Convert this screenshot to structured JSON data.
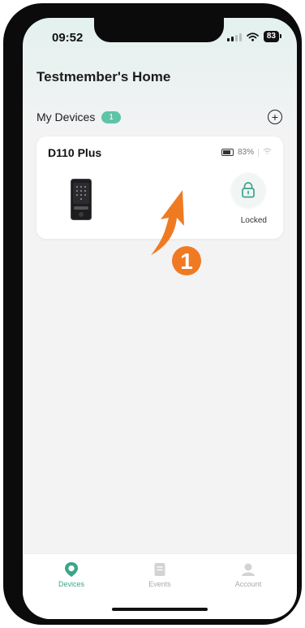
{
  "status_bar": {
    "time": "09:52",
    "battery": "83"
  },
  "home": {
    "title": "Testmember's Home"
  },
  "devices_section": {
    "label": "My Devices",
    "count": "1",
    "add_icon": "plus-circle-icon"
  },
  "device_card": {
    "name": "D110 Plus",
    "battery_percent": "83%",
    "lock_state": "Locked",
    "lock_icon": "padlock-icon"
  },
  "annotation": {
    "step_number": "1",
    "color": "#f07a22"
  },
  "tabs": [
    {
      "label": "Devices",
      "icon": "devices-icon",
      "active": true
    },
    {
      "label": "Events",
      "icon": "events-icon",
      "active": false
    },
    {
      "label": "Account",
      "icon": "account-icon",
      "active": false
    }
  ],
  "colors": {
    "accent": "#5ec3a7",
    "tab_active": "#3aa58a"
  }
}
